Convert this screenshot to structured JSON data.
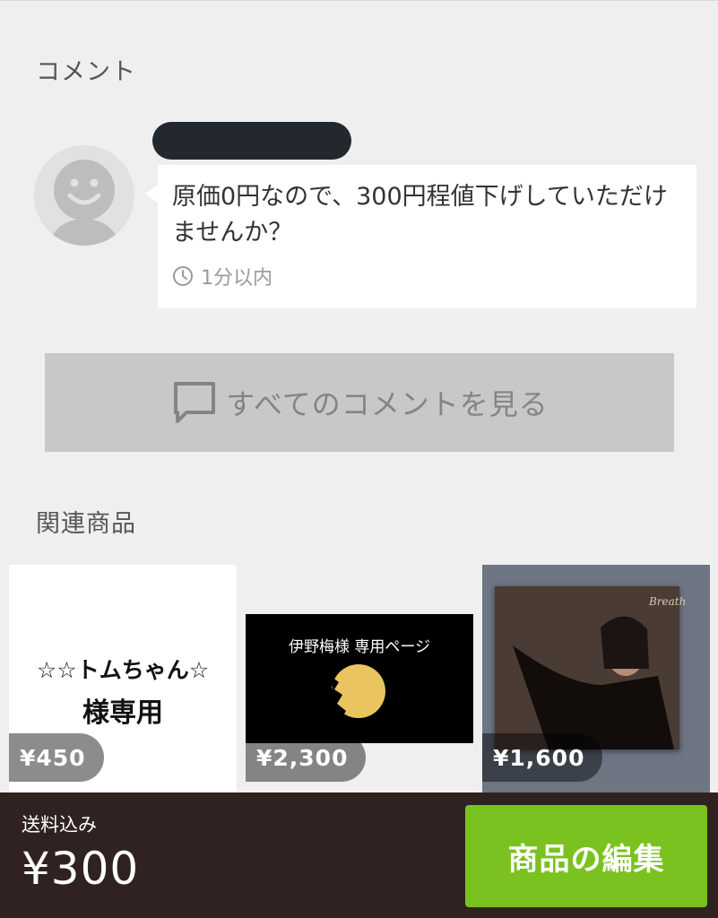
{
  "comments_section": {
    "title": "コメント",
    "comment": {
      "text": "原価0円なので、300円程値下げしていただけませんか？",
      "time": "1分以内"
    },
    "view_all_label": "すべてのコメントを見る"
  },
  "related": {
    "title": "関連商品",
    "products": [
      {
        "image_text_line1": "☆☆トムちゃん☆",
        "image_text_line2": "様専用",
        "price": "¥450"
      },
      {
        "image_text": "伊野梅様 専用ページ",
        "price": "¥2,300"
      },
      {
        "cover_text": "Breath",
        "price": "¥1,600"
      }
    ]
  },
  "footer": {
    "shipping_label": "送料込み",
    "price": "¥300",
    "edit_button_label": "商品の編集"
  },
  "colors": {
    "accent_green": "#7ac21f",
    "footer_bg": "#2f2220",
    "background": "#efefef"
  },
  "icons": [
    "user-avatar-icon",
    "clock-icon",
    "chat-icon"
  ]
}
